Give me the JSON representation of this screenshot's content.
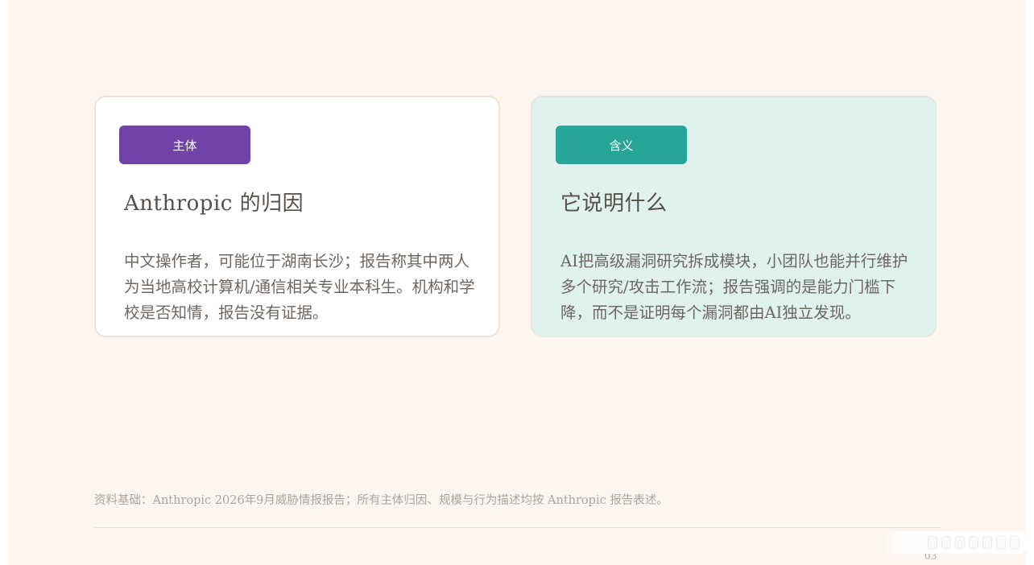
{
  "cards": [
    {
      "tag": "主体",
      "title": "Anthropic 的归因",
      "body": "中文操作者，可能位于湖南长沙；报告称其中两人为当地高校计算机/通信相关专业本科生。机构和学校是否知情，报告没有证据。"
    },
    {
      "tag": "含义",
      "title": "它说明什么",
      "body": "AI把高级漏洞研究拆成模块，小团队也能并行维护多个研究/攻击工作流；报告强调的是能力门槛下降，而不是证明每个漏洞都由AI独立发现。"
    }
  ],
  "footer": {
    "note": "资料基础：Anthropic 2026年9月威胁情报报告；所有主体归因、规模与行为描述均按 Anthropic 报告表述。",
    "page_number": "03"
  },
  "colors": {
    "tag_purple": "#7143a8",
    "tag_teal": "#27a597",
    "page_background": "#fdf6f0",
    "teal_card_background": "#dff2ee"
  }
}
